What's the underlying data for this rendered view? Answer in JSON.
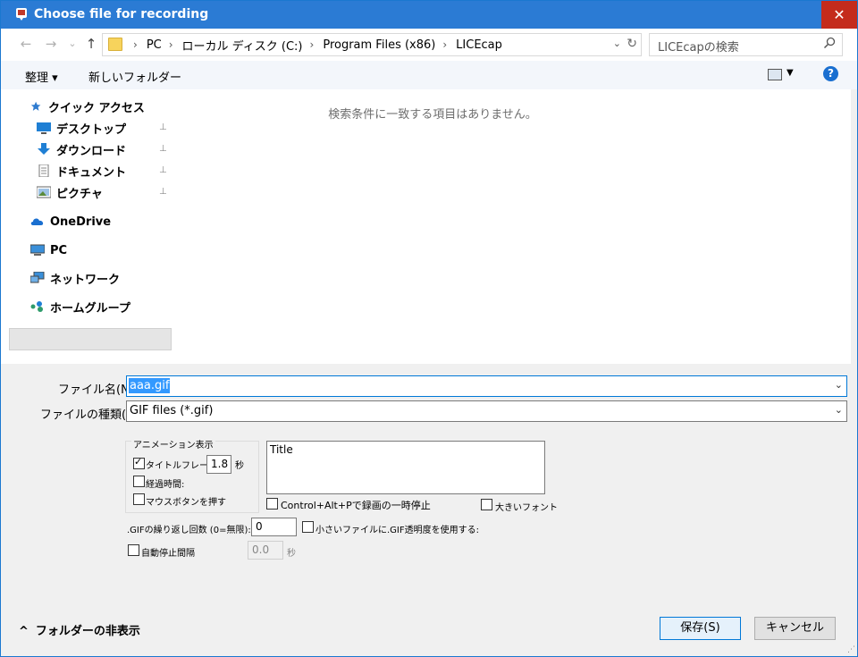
{
  "window": {
    "title": "Choose file for recording",
    "close_label": "✕"
  },
  "nav": {
    "back_icon": "←",
    "forward_icon": "→",
    "recent_icon": "⌄",
    "up_icon": "↑"
  },
  "address": {
    "crumbs": [
      "PC",
      "ローカル ディスク (C:)",
      "Program Files (x86)",
      "LICEcap"
    ],
    "separator": "›",
    "dropdown_icon": "⌄",
    "refresh_icon": "↻"
  },
  "search": {
    "placeholder": "LICEcapの検索"
  },
  "toolbar": {
    "organize_label": "整理 ▾",
    "new_folder_label": "新しいフォルダー",
    "view_dropdown": "▼",
    "help_label": "?"
  },
  "sidebar": {
    "quick_access": "クイック アクセス",
    "items": [
      {
        "label": "デスクトップ",
        "pinned": true
      },
      {
        "label": "ダウンロード",
        "pinned": true
      },
      {
        "label": "ドキュメント",
        "pinned": true
      },
      {
        "label": "ピクチャ",
        "pinned": true
      }
    ],
    "pin_icon": "📌",
    "onedrive": "OneDrive",
    "pc": "PC",
    "network": "ネットワーク",
    "homegroup": "ホームグループ"
  },
  "main": {
    "empty_message": "検索条件に一致する項目はありません。"
  },
  "form": {
    "filename_label": "ファイル名(N):",
    "filename_value": "aaa.gif",
    "filetype_label": "ファイルの種類(T):",
    "filetype_value": "GIF files (*.gif)",
    "combo_arrow": "⌄"
  },
  "options": {
    "group_title": "アニメーション表示",
    "title_frame_label": "タイトルフレーム:",
    "title_frame_checked": true,
    "title_frame_seconds": "1.8",
    "seconds_unit": "秒",
    "elapsed_label": "経過時間:",
    "elapsed_checked": false,
    "mouse_label": "マウスボタンを押す",
    "mouse_checked": false,
    "title_text": "Title",
    "pause_label": "Control+Alt+Pで録画の一時停止",
    "pause_checked": false,
    "large_font_label": "大きいフォント",
    "large_font_checked": false,
    "repeat_label": ".GIFの繰り返し回数 (0=無限):",
    "repeat_value": "0",
    "transparency_label": "小さいファイルに.GIF透明度を使用する:",
    "transparency_checked": false,
    "auto_stop_label": "自動停止間隔",
    "auto_stop_checked": false,
    "auto_stop_value": "0.0",
    "auto_stop_unit": "秒"
  },
  "footer": {
    "hide_folders_label": "フォルダーの非表示",
    "hide_folders_icon": "^",
    "save_label": "保存(S)",
    "cancel_label": "キャンセル"
  },
  "colors": {
    "titlebar": "#2b7bd4",
    "close": "#c42b1c",
    "selection": "#3399ff"
  }
}
